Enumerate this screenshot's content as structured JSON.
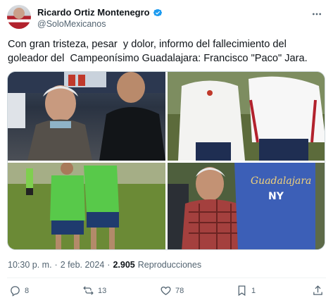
{
  "author": {
    "display_name": "Ricardo Ortiz Montenegro",
    "handle": "@SoloMexicanos",
    "verified": true,
    "avatar_icon": "profile-avatar"
  },
  "tweet": {
    "text": "Con gran tristeza, pesar  y dolor, informo del fallecimiento del goleador del  Campeonísimo Guadalajara: Francisco \"Paco\" Jara."
  },
  "media": {
    "count": 4,
    "photos": [
      {
        "description_icon": "photo-1"
      },
      {
        "description_icon": "photo-2"
      },
      {
        "description_icon": "photo-3"
      },
      {
        "description_icon": "photo-4"
      }
    ]
  },
  "meta": {
    "time": "10:30 p. m.",
    "separator": "·",
    "date": "2 feb. 2024",
    "views_count": "2.905",
    "views_label": "Reproducciones"
  },
  "actions": {
    "replies": "8",
    "retweets": "13",
    "likes": "78",
    "bookmarks": "1"
  },
  "colors": {
    "accent": "#1d9bf0",
    "text_secondary": "#536471",
    "text_primary": "#0f1419"
  }
}
